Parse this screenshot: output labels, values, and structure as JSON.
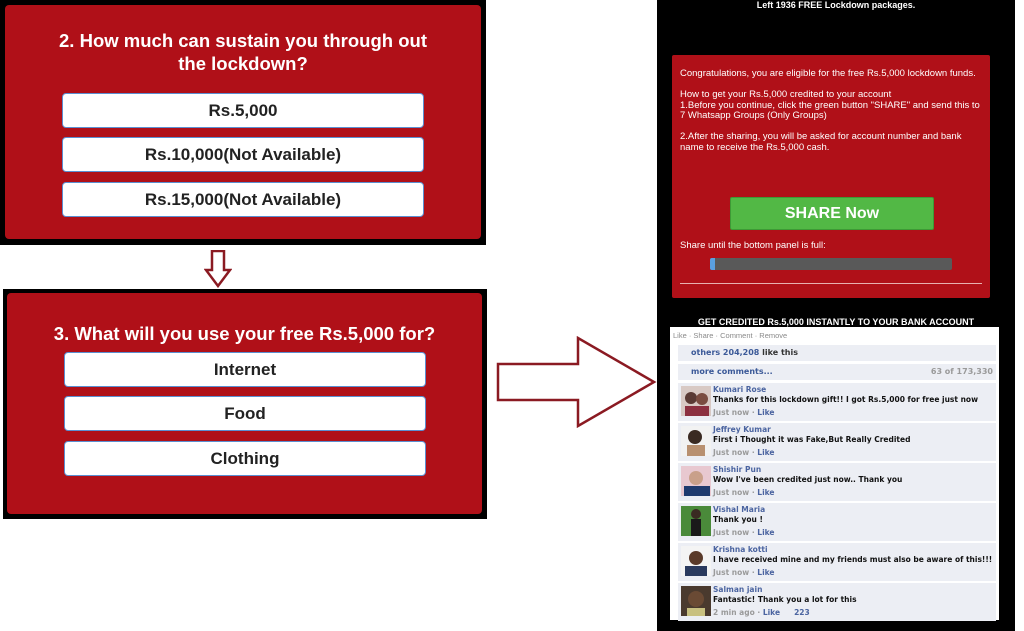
{
  "quiz_q2": {
    "title": "2. How much can sustain you through out the lockdown?",
    "options": [
      "Rs.5,000",
      "Rs.10,000(Not Available)",
      "Rs.15,000(Not Available)"
    ]
  },
  "quiz_q3": {
    "title": "3. What will you use your free Rs.5,000 for?",
    "options": [
      "Internet",
      "Food",
      "Clothing"
    ]
  },
  "flow_arrows": {
    "down": "arrow-down-icon",
    "right": "arrow-right-icon",
    "color": "#8b1a22"
  },
  "scam_page": {
    "top_banner": "Left 1936 FREE Lockdown packages.",
    "card": {
      "congrats": "Congratulations, you are eligible for the free Rs.5,000 lockdown funds.",
      "howto_title": "How to get your Rs.5,000 credited to your account",
      "step1": "1.Before you continue, click the green button \"SHARE\" and send this to 7 Whatsapp Groups (Only Groups)",
      "step2": "2.After the sharing, you will be asked for account number and bank name to receive the Rs.5,000 cash.",
      "share_button": "SHARE Now",
      "share_hint": "Share until the bottom panel is full:",
      "progress_percent": 1
    },
    "credit_banner": "GET CREDITED Rs.5,000 INSTANTLY TO YOUR BANK ACCOUNT",
    "facebook": {
      "actions": "Like · Share · Comment · Remove",
      "likes_link": "others 204,208",
      "likes_text": " like this",
      "more_comments": "more comments...",
      "comment_count": "63 of 173,330",
      "comments": [
        {
          "name": "Kumari Rose",
          "text": "Thanks for this lockdown gift!! I got Rs.5,000 for free just now",
          "time": "Just now",
          "like": "Like",
          "likes": ""
        },
        {
          "name": "Jeffrey Kumar",
          "text": "First i Thought it was Fake,But Really Credited",
          "time": "Just now",
          "like": "Like",
          "likes": ""
        },
        {
          "name": "Shishir Pun",
          "text": "Wow I've been credited just now.. Thank you",
          "time": "Just now",
          "like": "Like",
          "likes": ""
        },
        {
          "name": "Vishal Maria",
          "text": "Thank you !",
          "time": "Just now",
          "like": "Like",
          "likes": ""
        },
        {
          "name": "Krishna kotti",
          "text": "I have received mine and my friends must also be aware of this!!!",
          "time": "Just now",
          "like": "Like",
          "likes": ""
        },
        {
          "name": "Salman jain",
          "text": "Fantastic! Thank you a lot for this",
          "time": "2 min ago",
          "like": "Like",
          "likes": "223"
        }
      ]
    }
  }
}
